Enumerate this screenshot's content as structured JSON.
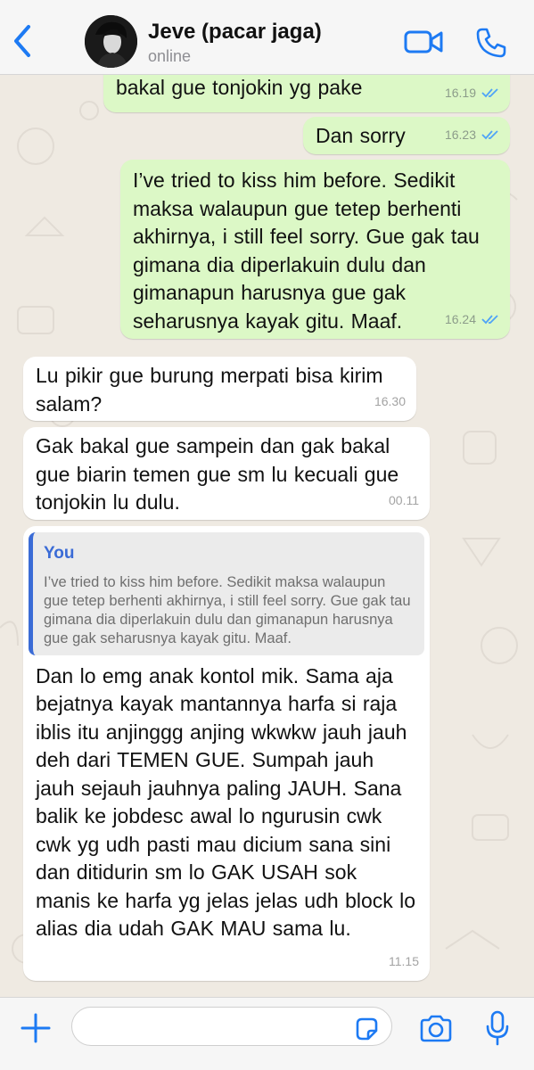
{
  "header": {
    "contact_name": "Jeve (pacar jaga)",
    "status": "online"
  },
  "messages": [
    {
      "type": "outgoing",
      "text": "bakal gue tonjokin yg pake",
      "time": "16.19",
      "status": "read"
    },
    {
      "type": "outgoing",
      "text": "Dan sorry",
      "time": "16.23",
      "status": "read"
    },
    {
      "type": "outgoing",
      "text": "I’ve tried to kiss him before. Sedikit maksa walaupun gue tetep berhenti akhirnya, i still feel sorry. Gue gak tau gimana dia diperlakuin dulu dan gimanapun harusnya gue gak seharusnya kayak gitu. Maaf.",
      "time": "16.24",
      "status": "read"
    },
    {
      "type": "incoming",
      "text": "Lu pikir gue burung merpati bisa kirim salam?",
      "time": "16.30"
    },
    {
      "type": "incoming",
      "text": "Gak bakal gue sampein dan gak bakal gue biarin temen gue sm lu kecuali gue tonjokin lu dulu.",
      "time": "00.11"
    },
    {
      "type": "incoming",
      "quote": {
        "author": "You",
        "text": "I’ve tried to kiss him before. Sedikit maksa walaupun gue tetep berhenti akhirnya, i still feel sorry. Gue gak tau gimana dia diperlakuin dulu dan gimanapun harusnya gue gak seharusnya kayak gitu. Maaf."
      },
      "text": "Dan lo emg anak kontol mik. Sama aja bejatnya kayak mantannya harfa si raja iblis itu anjinggg anjing wkwkw jauh jauh deh dari TEMEN GUE. Sumpah jauh jauh sejauh jauhnya paling JAUH. Sana balik ke jobdesc awal lo ngurusin cwk cwk yg udh pasti mau dicium sana sini dan ditidurin sm lo GAK USAH sok manis ke harfa yg jelas jelas udh block lo alias dia udah GAK MAU sama lu.",
      "time": "11.15"
    }
  ],
  "composer": {
    "placeholder": ""
  },
  "icons": {
    "back": "chevron-left-icon",
    "video": "video-camera-icon",
    "call": "phone-icon",
    "plus": "plus-icon",
    "sticker": "sticker-icon",
    "camera": "camera-icon",
    "mic": "microphone-icon",
    "read_ticks": "double-check-icon"
  },
  "colors": {
    "accent": "#1d7af3",
    "outgoing_bubble": "#dcf8c6",
    "incoming_bubble": "#ffffff",
    "quote_bar": "#3a6bd6",
    "read_tick": "#4fa3f7"
  }
}
